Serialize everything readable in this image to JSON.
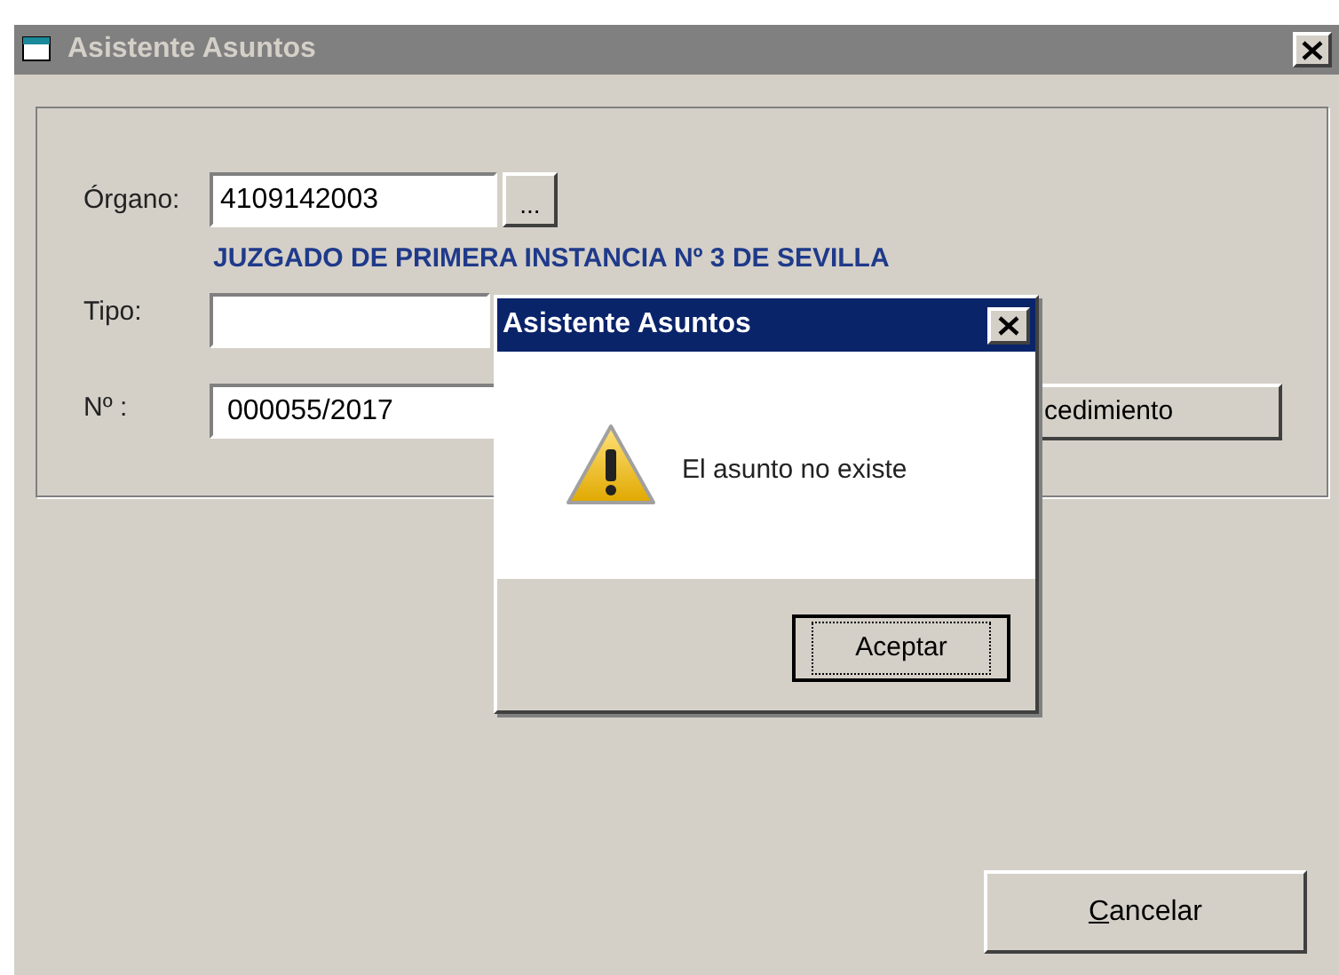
{
  "window": {
    "title": "Asistente Asuntos",
    "active": false
  },
  "form": {
    "organo": {
      "label": "Órgano:",
      "value": "4109142003",
      "browse": "..."
    },
    "organo_name": "JUZGADO DE PRIMERA INSTANCIA Nº 3 DE SEVILLA",
    "tipo": {
      "label": "Tipo:"
    },
    "numero": {
      "label": "Nº :",
      "value": "000055/2017"
    },
    "procedure_button": "cedimiento"
  },
  "cancel_button": {
    "label": "Cancelar",
    "mnemonic_underlined": true
  },
  "dialog": {
    "title": "Asistente Asuntos",
    "active": true,
    "kind": "warning",
    "message": "El asunto no existe",
    "ok_button": {
      "label": "Aceptar",
      "focused": true
    }
  }
}
